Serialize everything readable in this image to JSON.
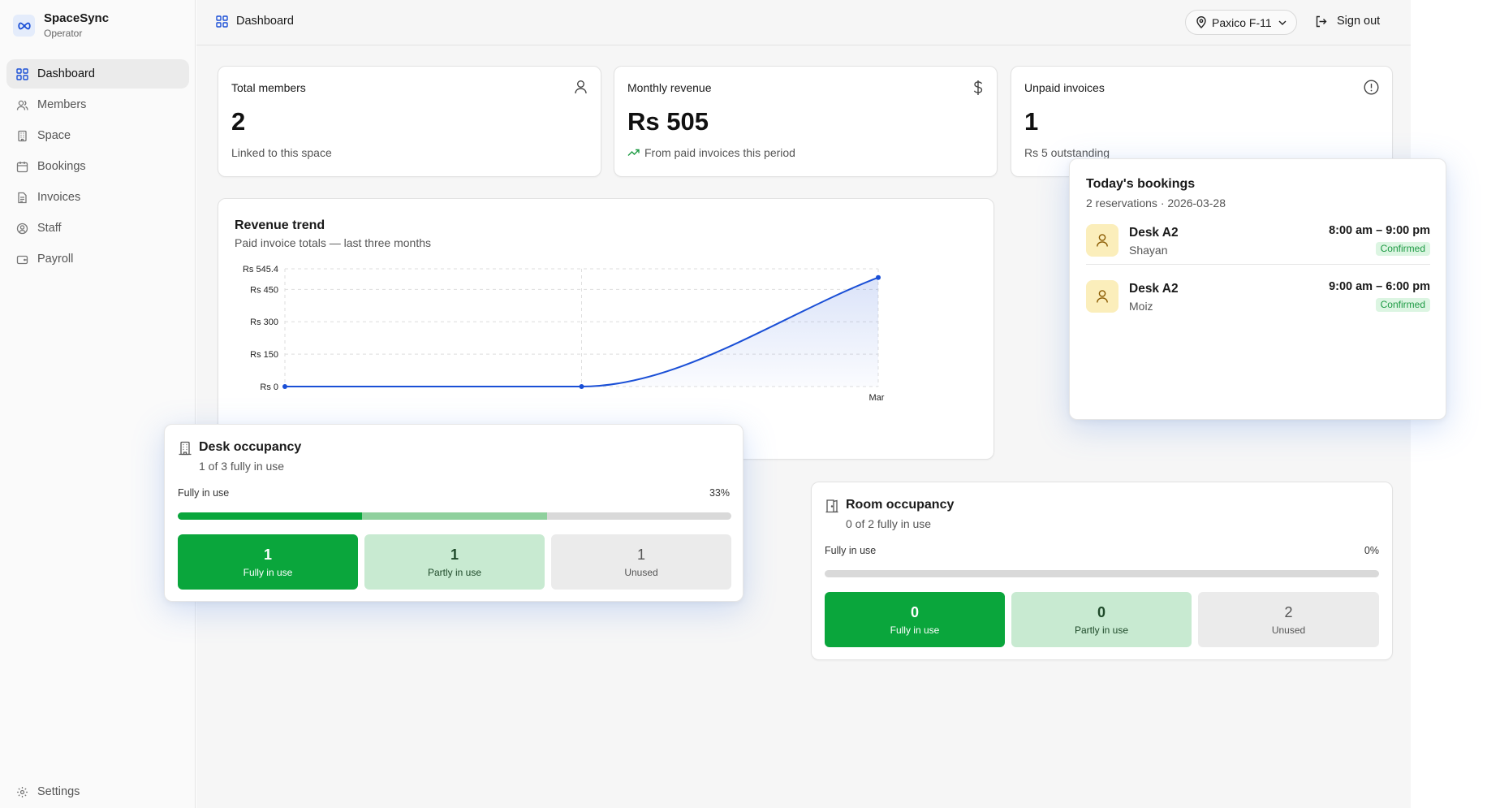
{
  "app": {
    "name": "SpaceSync",
    "role": "Operator"
  },
  "sidebar": {
    "items": [
      {
        "label": "Dashboard",
        "icon": "dashboard-icon"
      },
      {
        "label": "Members",
        "icon": "users-icon"
      },
      {
        "label": "Space",
        "icon": "building-icon"
      },
      {
        "label": "Bookings",
        "icon": "calendar-icon"
      },
      {
        "label": "Invoices",
        "icon": "file-icon"
      },
      {
        "label": "Staff",
        "icon": "user-circle-icon"
      },
      {
        "label": "Payroll",
        "icon": "wallet-icon"
      }
    ],
    "settings_label": "Settings"
  },
  "topbar": {
    "title": "Dashboard",
    "location": "Paxico F-11",
    "sign_out": "Sign out"
  },
  "stats": [
    {
      "title": "Total members",
      "value": "2",
      "sub": "Linked to this space",
      "icon": "user-icon"
    },
    {
      "title": "Monthly revenue",
      "value": "Rs 505",
      "sub": "From paid invoices this period",
      "icon": "dollar-icon"
    },
    {
      "title": "Unpaid invoices",
      "value": "1",
      "sub": "Rs 5 outstanding",
      "icon": "alert-circle-icon"
    }
  ],
  "revenue_chart": {
    "title": "Revenue trend",
    "subtitle": "Paid invoice totals — last three months"
  },
  "chart_data": {
    "type": "area",
    "title": "Revenue trend",
    "x": [
      "",
      "",
      "Mar"
    ],
    "y": [
      0,
      0,
      505
    ],
    "yticks": [
      "Rs 0",
      "Rs 150",
      "Rs 300",
      "Rs 450",
      "Rs 545.4"
    ],
    "ytick_values": [
      0,
      150,
      300,
      450,
      545.4
    ],
    "ylim": [
      0,
      545.4
    ],
    "grid": true,
    "color": "#1a4fd6"
  },
  "desk_occupancy": {
    "title": "Desk occupancy",
    "subtitle": "1 of 3 fully in use",
    "label": "Fully in use",
    "percent": "33%",
    "full_fraction": 0.3333,
    "partial_fraction": 0.3333,
    "tiles": [
      {
        "count": "1",
        "label": "Fully in use"
      },
      {
        "count": "1",
        "label": "Partly in use"
      },
      {
        "count": "1",
        "label": "Unused"
      }
    ]
  },
  "room_occupancy": {
    "title": "Room occupancy",
    "subtitle": "0 of 2 fully in use",
    "label": "Fully in use",
    "percent": "0%",
    "full_fraction": 0,
    "partial_fraction": 0,
    "tiles": [
      {
        "count": "0",
        "label": "Fully in use"
      },
      {
        "count": "0",
        "label": "Partly in use"
      },
      {
        "count": "2",
        "label": "Unused"
      }
    ]
  },
  "bookings": {
    "title": "Today's bookings",
    "subtitle": "2 reservations · 2026-03-28",
    "items": [
      {
        "desk": "Desk A2",
        "name": "Shayan",
        "time": "8:00 am – 9:00 pm",
        "status": "Confirmed"
      },
      {
        "desk": "Desk A2",
        "name": "Moiz",
        "time": "9:00 am – 6:00 pm",
        "status": "Confirmed"
      }
    ]
  },
  "colors": {
    "accent": "#1a4fd6",
    "green": "#0aa63c",
    "green_light": "#c8ead1"
  }
}
